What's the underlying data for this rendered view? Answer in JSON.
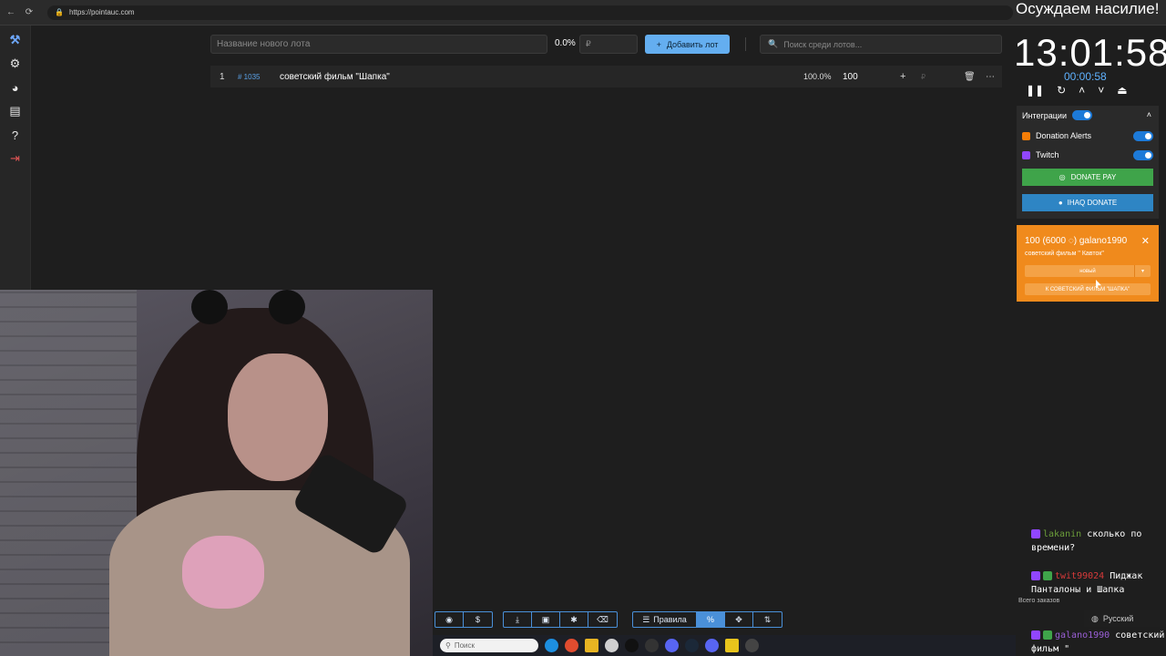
{
  "browser": {
    "url": "https://pointauc.com"
  },
  "header": {
    "lot_placeholder": "Название нового лота",
    "pct": "0.0%",
    "currency_placeholder": "₽",
    "add_label": "Добавить лот",
    "search_placeholder": "Поиск среди лотов..."
  },
  "lots": [
    {
      "num": "1",
      "id": "# 1035",
      "name": "советский фильм \"Шапка\"",
      "pct": "100.0%",
      "amount": "100",
      "currency": "₽"
    }
  ],
  "toolbar": {
    "rules_label": "Правила"
  },
  "taskbar": {
    "search_label": "Поиск"
  },
  "overlay": {
    "ticker": "Осуждаем насилие!",
    "clock": "13:01:58",
    "clock_sub": "00:00:58"
  },
  "integrations": {
    "title": "Интеграции",
    "items": [
      {
        "label": "Donation Alerts"
      },
      {
        "label": "Twitch"
      }
    ],
    "donate_pay": "DONATE PAY",
    "ihaq": "IHAQ DONATE"
  },
  "donation": {
    "title": "100 (6000 ◌) galano1990",
    "subtitle": "советский фильм \" Кавток\"",
    "select_value": "новый",
    "action": "К СОВЕТСКИЙ ФИЛЬМ \"ШАПКА\""
  },
  "chat": {
    "messages": [
      {
        "user": "lakanin",
        "text": "сколько по времени?"
      },
      {
        "user": "twit99024",
        "text": "Пиджак Панталоны и Шапка"
      },
      {
        "user": "galano1990",
        "text": "советский фильм \""
      }
    ],
    "all_orders": "Всего заказов",
    "language": "Русский"
  },
  "colors": {
    "accent": "#64aef0",
    "donation": "#f08a1c",
    "donate_pay": "#3fa44a",
    "ihaq": "#2e85c4"
  }
}
